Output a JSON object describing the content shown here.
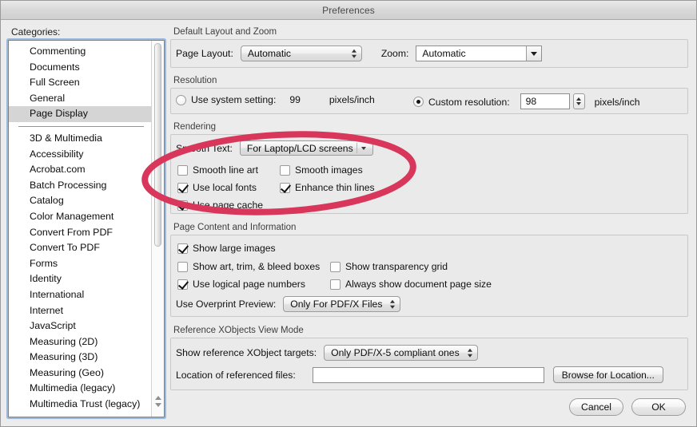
{
  "window": {
    "title": "Preferences"
  },
  "sidebar": {
    "label": "Categories:",
    "top_items": [
      {
        "label": "Commenting",
        "selected": false
      },
      {
        "label": "Documents",
        "selected": false
      },
      {
        "label": "Full Screen",
        "selected": false
      },
      {
        "label": "General",
        "selected": false
      },
      {
        "label": "Page Display",
        "selected": true
      }
    ],
    "bottom_items": [
      {
        "label": "3D & Multimedia"
      },
      {
        "label": "Accessibility"
      },
      {
        "label": "Acrobat.com"
      },
      {
        "label": "Batch Processing"
      },
      {
        "label": "Catalog"
      },
      {
        "label": "Color Management"
      },
      {
        "label": "Convert From PDF"
      },
      {
        "label": "Convert To PDF"
      },
      {
        "label": "Forms"
      },
      {
        "label": "Identity"
      },
      {
        "label": "International"
      },
      {
        "label": "Internet"
      },
      {
        "label": "JavaScript"
      },
      {
        "label": "Measuring (2D)"
      },
      {
        "label": "Measuring (3D)"
      },
      {
        "label": "Measuring (Geo)"
      },
      {
        "label": "Multimedia (legacy)"
      },
      {
        "label": "Multimedia Trust (legacy)"
      }
    ]
  },
  "layout_group": {
    "title": "Default Layout and Zoom",
    "page_layout_label": "Page Layout:",
    "page_layout_value": "Automatic",
    "zoom_label": "Zoom:",
    "zoom_value": "Automatic"
  },
  "resolution_group": {
    "title": "Resolution",
    "system_radio_label": "Use system setting:",
    "system_radio_selected": false,
    "system_value": "99",
    "system_units": "pixels/inch",
    "custom_radio_label": "Custom resolution:",
    "custom_radio_selected": true,
    "custom_value": "98",
    "custom_units": "pixels/inch"
  },
  "rendering_group": {
    "title": "Rendering",
    "smooth_text_label": "Smooth Text:",
    "smooth_text_value": "For Laptop/LCD screens",
    "checkboxes": [
      {
        "label": "Smooth line art",
        "checked": false
      },
      {
        "label": "Smooth images",
        "checked": false
      },
      {
        "label": "Use local fonts",
        "checked": true
      },
      {
        "label": "Enhance thin lines",
        "checked": true
      },
      {
        "label": "Use page cache",
        "checked": true
      }
    ]
  },
  "page_content_group": {
    "title": "Page Content and Information",
    "checkboxes": [
      {
        "label": "Show large images",
        "checked": true
      },
      {
        "label": "Show art, trim, & bleed boxes",
        "checked": false
      },
      {
        "label": "Show transparency grid",
        "checked": false
      },
      {
        "label": "Use logical page numbers",
        "checked": true
      },
      {
        "label": "Always show document page size",
        "checked": false
      }
    ],
    "overprint_label": "Use Overprint Preview:",
    "overprint_value": "Only For PDF/X Files"
  },
  "xobjects_group": {
    "title": "Reference XObjects View Mode",
    "targets_label": "Show reference XObject targets:",
    "targets_value": "Only PDF/X-5 compliant ones",
    "location_label": "Location of referenced files:",
    "location_value": "",
    "browse_label": "Browse for Location..."
  },
  "footer": {
    "cancel_label": "Cancel",
    "ok_label": "OK"
  },
  "annotation": {
    "shape": "ellipse-highlight",
    "color": "#d9365c"
  }
}
